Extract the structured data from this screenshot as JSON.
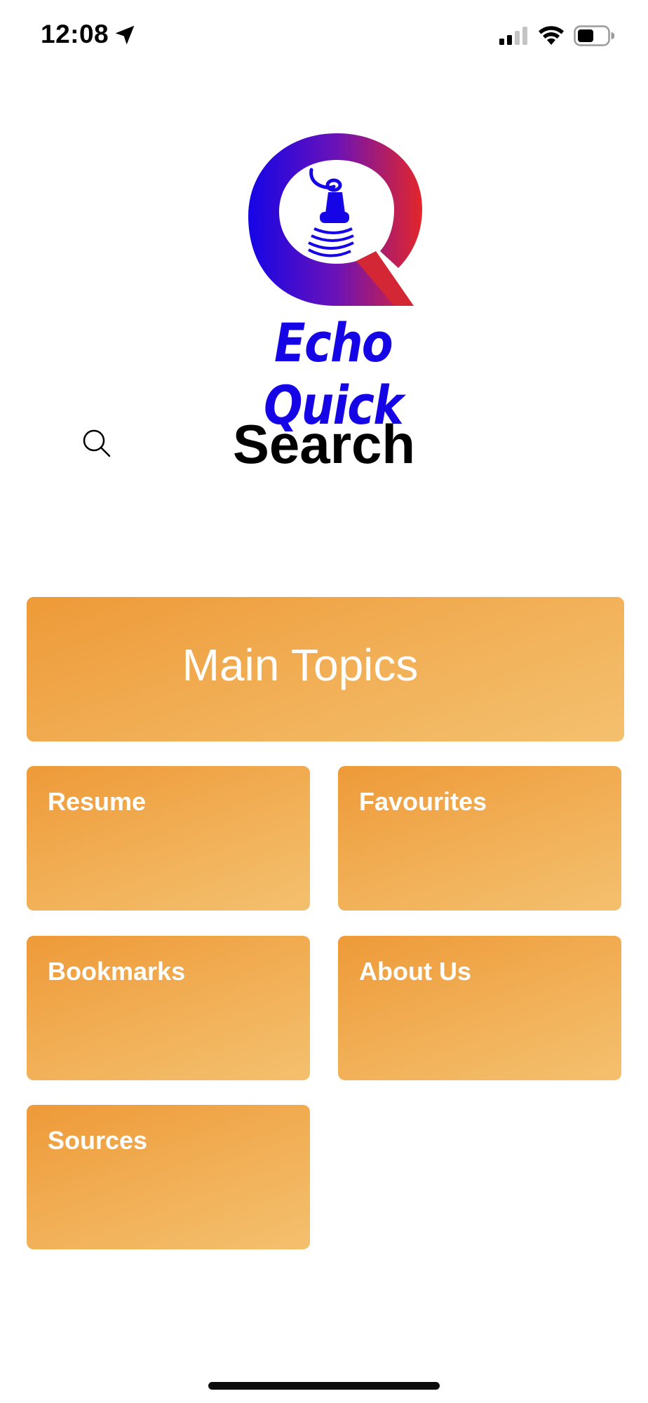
{
  "status_bar": {
    "time": "12:08",
    "icons": [
      "location-arrow-icon",
      "cellular-signal-icon",
      "wifi-icon",
      "battery-icon"
    ]
  },
  "logo": {
    "text": "Echo Quick",
    "colors": {
      "gradient_start": "#1505e6",
      "gradient_end": "#e3262a",
      "text": "#1505e6"
    }
  },
  "search": {
    "icon": "search-icon",
    "label": "Search"
  },
  "menu": {
    "main_label": "Main Topics",
    "tiles": [
      {
        "label": "Resume"
      },
      {
        "label": "Favourites"
      },
      {
        "label": "Bookmarks"
      },
      {
        "label": "About Us"
      },
      {
        "label": "Sources"
      }
    ]
  },
  "theme": {
    "tile_color_start": "#ee9a38",
    "tile_color_end": "#f4c06e",
    "tile_text": "#ffffff"
  }
}
